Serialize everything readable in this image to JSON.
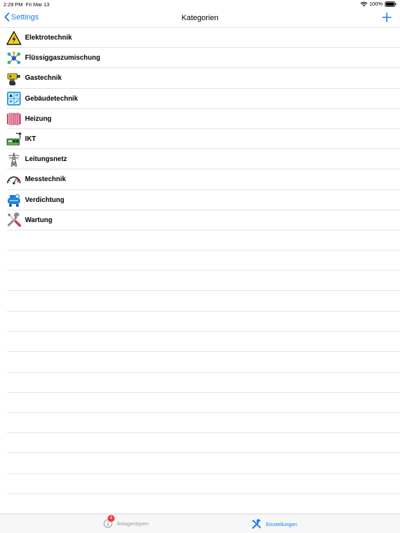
{
  "status_bar": {
    "time": "2:29 PM",
    "date": "Fri Mar 13",
    "battery": "100%",
    "icons": [
      "wifi-icon",
      "battery-icon"
    ]
  },
  "nav": {
    "back_label": "Settings",
    "title": "Kategorien",
    "add_icon": "plus-icon"
  },
  "categories": [
    {
      "label": "Elektrotechnik",
      "icon": "high-voltage-warning-icon"
    },
    {
      "label": "Flüssiggaszumischung",
      "icon": "molecule-icon"
    },
    {
      "label": "Gastechnik",
      "icon": "gas-burner-icon"
    },
    {
      "label": "Gebäudetechnik",
      "icon": "building-grid-icon"
    },
    {
      "label": "Heizung",
      "icon": "radiator-icon"
    },
    {
      "label": "IKT",
      "icon": "network-board-icon"
    },
    {
      "label": "Leitungsnetz",
      "icon": "power-pylon-icon"
    },
    {
      "label": "Messtechnik",
      "icon": "gauge-icon"
    },
    {
      "label": "Verdichtung",
      "icon": "compressor-icon"
    },
    {
      "label": "Wartung",
      "icon": "tools-icon"
    }
  ],
  "tab_bar": {
    "tabs": [
      {
        "label": "Anlagentypen",
        "icon": "info-icon",
        "badge": "4",
        "selected": false
      },
      {
        "label": "Einstellungen",
        "icon": "tools-icon",
        "selected": true
      }
    ]
  },
  "colors": {
    "accent": "#1a7cf5",
    "badge": "#f2383a",
    "separator": "#e2e2e4",
    "tab_inactive": "#9a9a9e"
  }
}
